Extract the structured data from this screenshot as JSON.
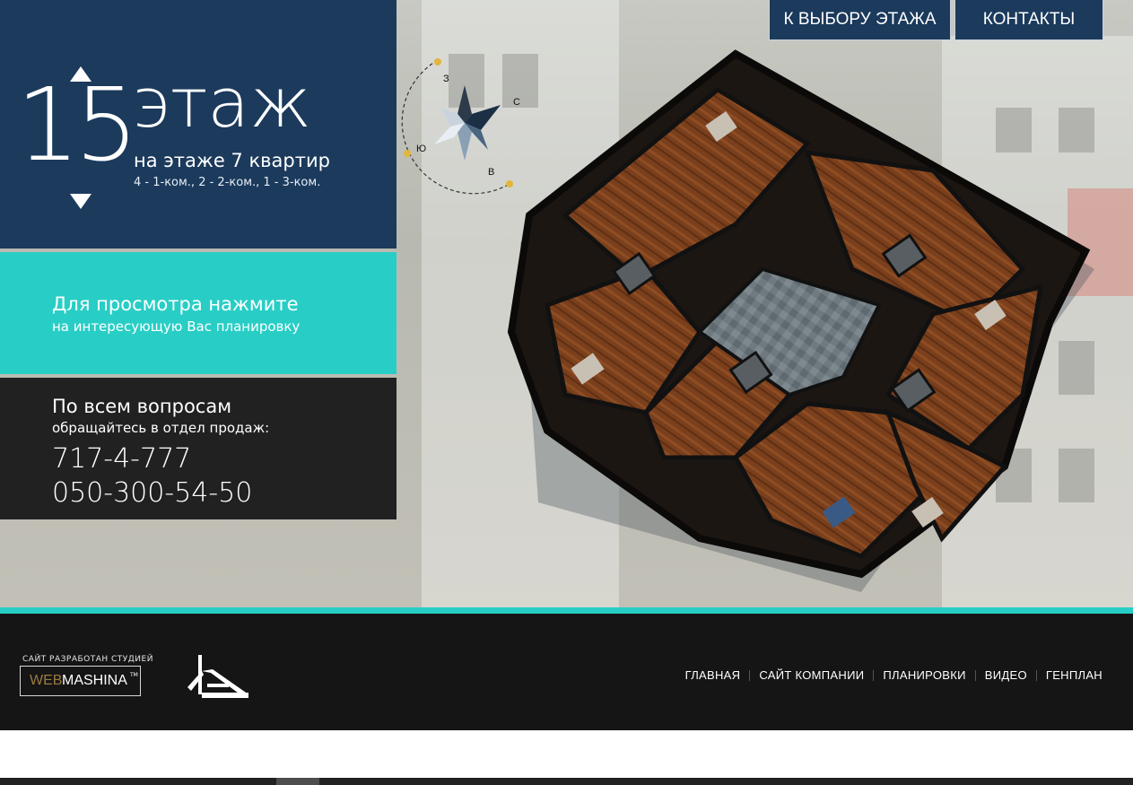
{
  "nav_top": {
    "floor_select": "К ВЫБОРУ ЭТАЖА",
    "contacts": "КОНТАКТЫ"
  },
  "floor": {
    "number": "15",
    "word": "этаж",
    "apartments": "на этаже 7 квартир",
    "breakdown": "4 - 1-ком., 2 - 2-ком., 1 - 3-ком.",
    "up_icon": "triangle-up-icon",
    "down_icon": "triangle-down-icon"
  },
  "hint": {
    "title": "Для просмотра нажмите",
    "subtitle": "на интересующую Вас планировку"
  },
  "contact_panel": {
    "title": "По всем вопросам",
    "subtitle": "обращайтесь в отдел продаж:",
    "phones": [
      "717-4-777",
      "050-300-54-50"
    ]
  },
  "compass": {
    "west": "З",
    "north": "С",
    "south": "Ю",
    "east": "В"
  },
  "footer": {
    "studio_caption": "САЙТ РАЗРАБОТАН СТУДИЕЙ",
    "studio_web": "WEB",
    "studio_mashina": "MASHINA",
    "studio_tm": "TM",
    "links": [
      "ГЛАВНАЯ",
      "САЙТ КОМПАНИИ",
      "ПЛАНИРОВКИ",
      "ВИДЕО",
      "ГЕНПЛАН"
    ]
  },
  "colors": {
    "navy": "#1b3a5c",
    "teal": "#28cec5",
    "dark": "#212121",
    "footer": "#151515"
  }
}
